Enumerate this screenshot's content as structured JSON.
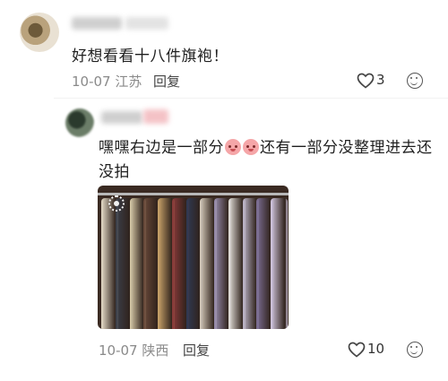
{
  "comment": {
    "text": "好想看看十八件旗袍！",
    "date": "10-07",
    "location": "江苏",
    "reply_label": "回复",
    "likes": "3"
  },
  "reply_comment": {
    "text_part1": "嘿嘿右边是一部分",
    "text_part2": "还有一部分没整理进去还没拍",
    "emoji_names": [
      "pig-face-icon",
      "pig-face-icon"
    ],
    "date": "10-07",
    "location": "陕西",
    "reply_label": "回复",
    "likes": "10"
  },
  "photo": {
    "subject": "clothes-rack-photo",
    "garment_colors": [
      "#e6dcc8",
      "#3b3f4a",
      "#d9cba8",
      "#6a4a3a",
      "#caa46a",
      "#8b3a3a",
      "#2f3a55",
      "#d8cdbd",
      "#9a8fb0",
      "#e5e2dc",
      "#bdb6c9",
      "#7d6f96",
      "#d3c8e0"
    ]
  },
  "colors": {
    "text": "#1f1f1f",
    "meta": "#8a8a8a",
    "name_tag_pink": "#f4c2c6"
  }
}
